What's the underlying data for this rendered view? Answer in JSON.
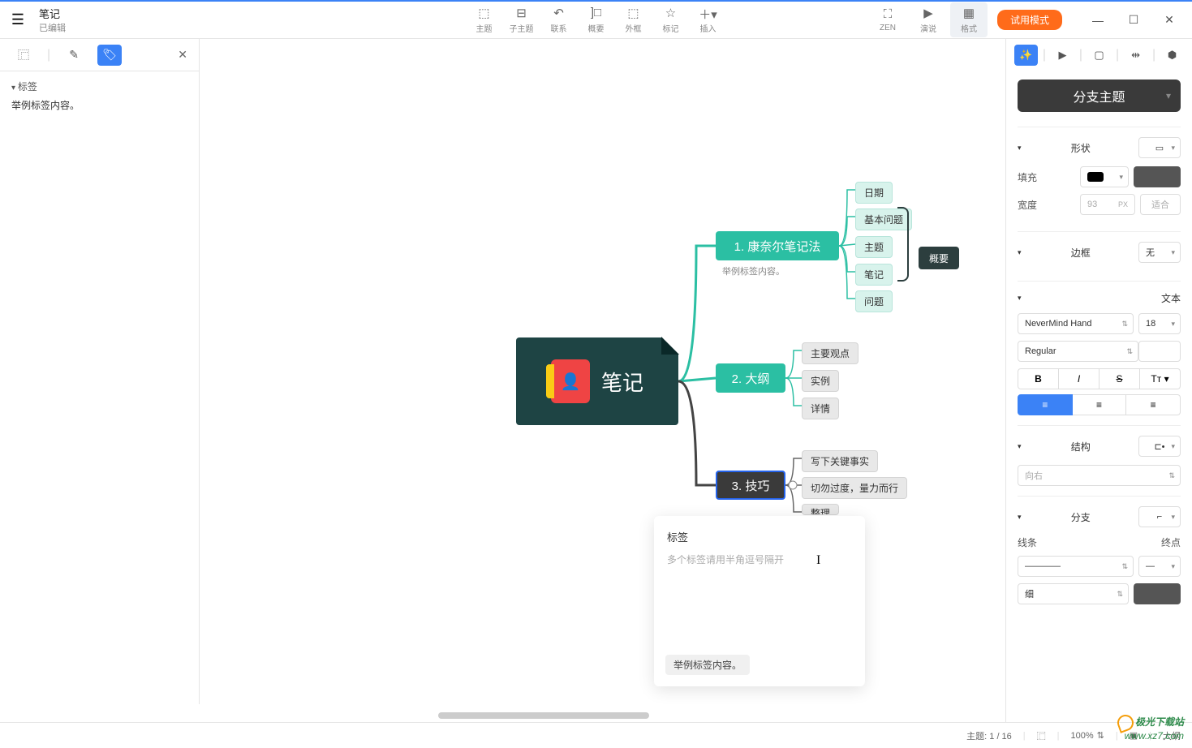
{
  "header": {
    "title": "笔记",
    "subtitle": "已编辑",
    "tools": [
      {
        "icon": "⬚",
        "label": "主题"
      },
      {
        "icon": "⬚",
        "label": "子主题"
      },
      {
        "icon": "↶",
        "label": "联系"
      },
      {
        "icon": "⬚",
        "label": "概要"
      },
      {
        "icon": "▭",
        "label": "外框"
      },
      {
        "icon": "☆",
        "label": "标记"
      },
      {
        "icon": "＋",
        "label": "插入"
      }
    ],
    "right_tools": [
      {
        "icon": "⛶",
        "label": "ZEN"
      },
      {
        "icon": "▶",
        "label": "演说"
      },
      {
        "icon": "▦",
        "label": "格式"
      }
    ],
    "trial_label": "试用模式"
  },
  "left": {
    "section_title": "标签",
    "example_text": "举例标签内容。"
  },
  "mindmap": {
    "root": "笔记",
    "branch1": "1. 康奈尔笔记法",
    "branch1_tag": "举例标签内容。",
    "branch1_children": [
      "日期",
      "基本问题",
      "主题",
      "笔记",
      "问题"
    ],
    "summary": "概要",
    "branch2": "2. 大纲",
    "branch2_children": [
      "主要观点",
      "实例",
      "详情"
    ],
    "branch3": "3. 技巧",
    "branch3_children": [
      "写下关键事实",
      "切勿过度，量力而行",
      "整理"
    ]
  },
  "popup": {
    "title": "标签",
    "placeholder": "多个标签请用半角逗号隔开",
    "chip": "举例标签内容。"
  },
  "right": {
    "main_dropdown": "分支主题",
    "shape": {
      "title": "形状",
      "fill_label": "填充",
      "width_label": "宽度",
      "width_value": "93",
      "width_unit": "PX",
      "fit_label": "适合"
    },
    "border": {
      "title": "边框",
      "value": "无"
    },
    "text": {
      "title": "文本",
      "font": "NeverMind Hand",
      "size": "18",
      "weight": "Regular"
    },
    "structure": {
      "title": "结构",
      "direction": "向右"
    },
    "branch": {
      "title": "分支",
      "line_label": "线条",
      "end_label": "终点",
      "thickness": "细"
    }
  },
  "statusbar": {
    "topic": "主题: 1 / 16",
    "zoom": "100%",
    "outline": "大纲"
  },
  "watermark": {
    "brand": "极光下载站",
    "url": "www.xz7.com"
  }
}
